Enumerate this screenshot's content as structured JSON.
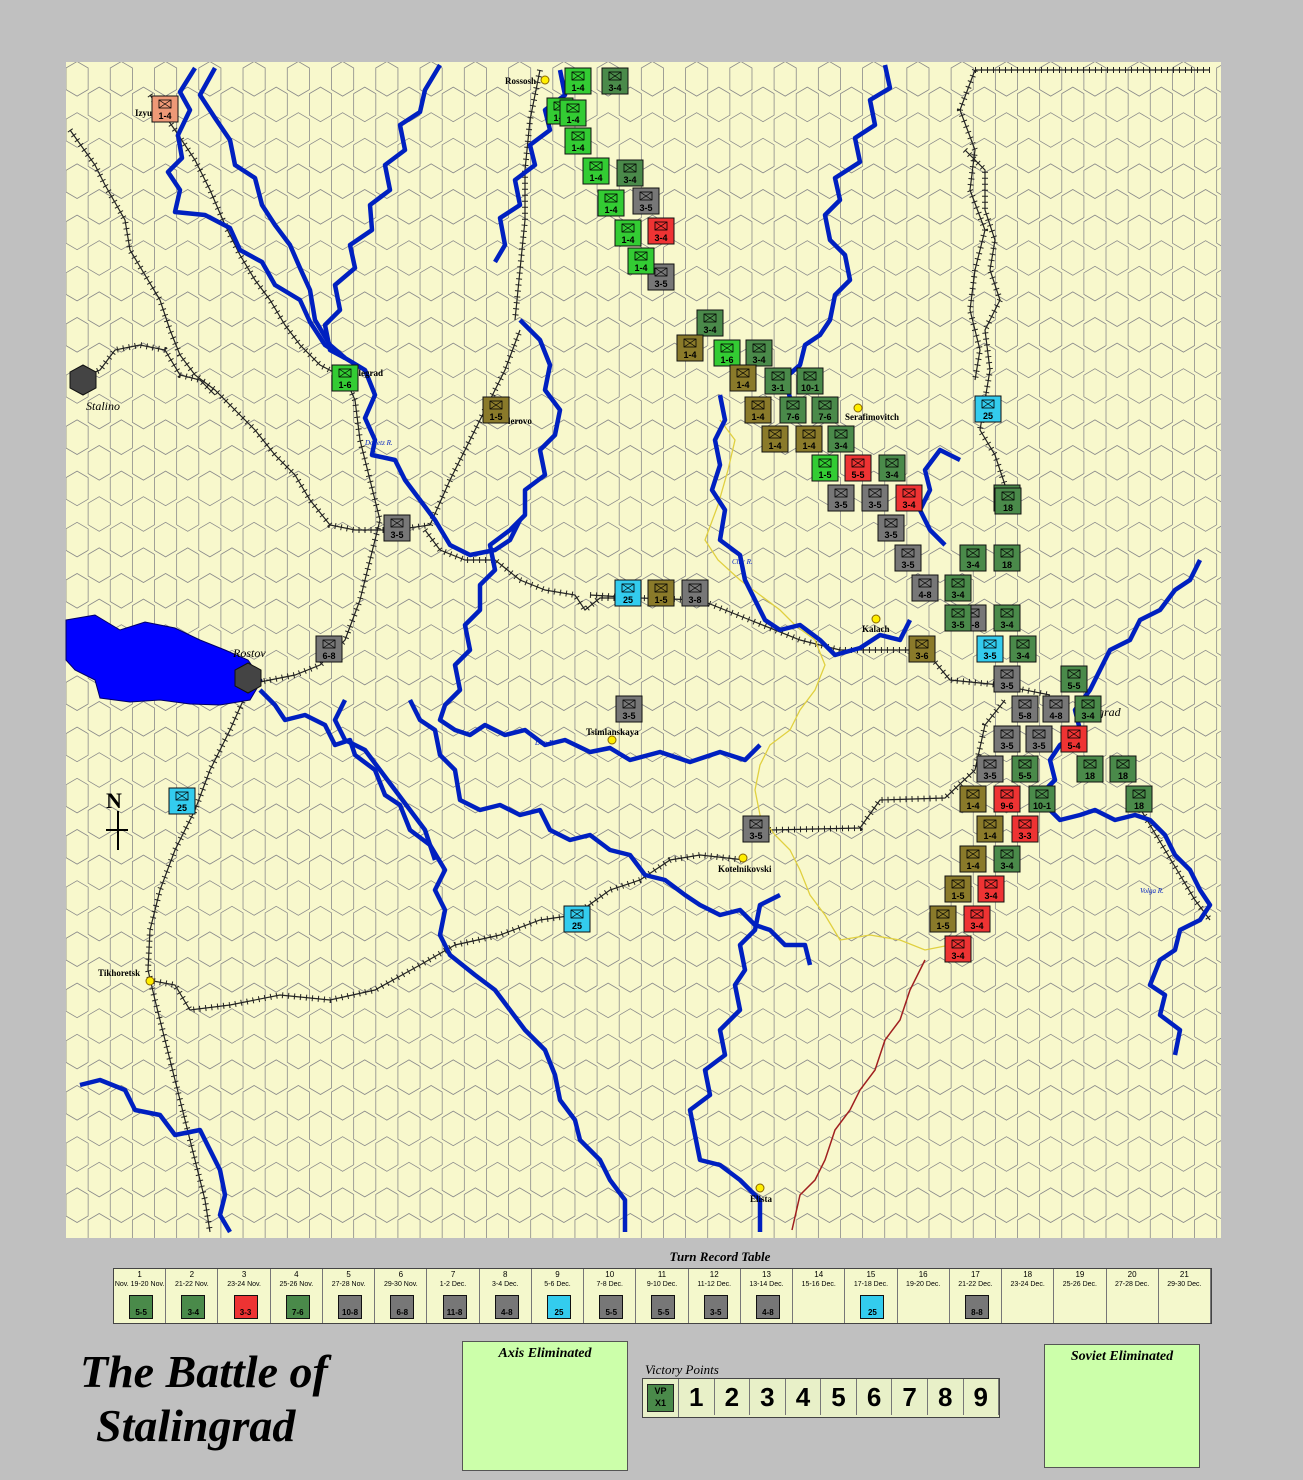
{
  "title": {
    "line1": "The Battle of",
    "line2": "Stalingrad"
  },
  "turn_record": {
    "title": "Turn Record Table",
    "turns": [
      {
        "num": "1",
        "date": "Nov. 19-20 Nov."
      },
      {
        "num": "2",
        "date": "21-22 Nov."
      },
      {
        "num": "3",
        "date": "23-24 Nov."
      },
      {
        "num": "4",
        "date": "25-26 Nov."
      },
      {
        "num": "5",
        "date": "27-28 Nov."
      },
      {
        "num": "6",
        "date": "29-30 Nov."
      },
      {
        "num": "7",
        "date": "1-2 Dec."
      },
      {
        "num": "8",
        "date": "3-4 Dec."
      },
      {
        "num": "9",
        "date": "5-6 Dec."
      },
      {
        "num": "10",
        "date": "7-8 Dec."
      },
      {
        "num": "11",
        "date": "9-10 Dec."
      },
      {
        "num": "12",
        "date": "11-12 Dec."
      },
      {
        "num": "13",
        "date": "13-14 Dec."
      },
      {
        "num": "14",
        "date": "15-16 Dec."
      },
      {
        "num": "15",
        "date": "17-18 Dec."
      },
      {
        "num": "16",
        "date": "19-20 Dec."
      },
      {
        "num": "17",
        "date": "21-22 Dec."
      },
      {
        "num": "18",
        "date": "23-24 Dec."
      },
      {
        "num": "19",
        "date": "25-26 Dec."
      },
      {
        "num": "20",
        "date": "27-28 Dec."
      },
      {
        "num": "21",
        "date": "29-30 Dec."
      }
    ],
    "reinforcements": [
      {
        "turn": 1,
        "label": "5-5",
        "color": "#4a8a4a"
      },
      {
        "turn": 2,
        "label": "3-4",
        "color": "#4a8a4a"
      },
      {
        "turn": 3,
        "label": "3-3",
        "color": "#ee3333"
      },
      {
        "turn": 4,
        "label": "7-6",
        "color": "#4a8a4a"
      },
      {
        "turn": 5,
        "label": "10-8",
        "color": "#777777"
      },
      {
        "turn": 6,
        "label": "6-8",
        "color": "#777777"
      },
      {
        "turn": 7,
        "label": "11-8",
        "color": "#777777"
      },
      {
        "turn": 8,
        "label": "4-8",
        "color": "#777777"
      },
      {
        "turn": 9,
        "label": "25",
        "color": "#33ccee"
      },
      {
        "turn": 10,
        "label": "5-5",
        "color": "#777777"
      },
      {
        "turn": 11,
        "label": "5-5",
        "color": "#777777"
      },
      {
        "turn": 12,
        "label": "3-5",
        "color": "#777777"
      },
      {
        "turn": 13,
        "label": "4-8",
        "color": "#777777"
      },
      {
        "turn": 15,
        "label": "25",
        "color": "#33ccee"
      },
      {
        "turn": 17,
        "label": "8-8",
        "color": "#777777"
      }
    ]
  },
  "eliminated": {
    "axis": "Axis Eliminated",
    "soviet": "Soviet Eliminated"
  },
  "victory_points": {
    "label": "Victory Points",
    "marker_line1": "VP",
    "marker_line2": "X1",
    "values": [
      "1",
      "2",
      "3",
      "4",
      "5",
      "6",
      "7",
      "8",
      "9"
    ]
  },
  "places": [
    {
      "name": "Rossosh",
      "kind": "small"
    },
    {
      "name": "Izyu",
      "kind": "small"
    },
    {
      "name": "Voroshilovgrad",
      "label": "ilegrad",
      "kind": "small"
    },
    {
      "name": "Stalino",
      "kind": "italic"
    },
    {
      "name": "Millerovo",
      "label": "lerovo",
      "kind": "small"
    },
    {
      "name": "Serafimovitch",
      "kind": "small"
    },
    {
      "name": "Kalach",
      "kind": "small"
    },
    {
      "name": "Stalingrad",
      "label": "ngrad",
      "kind": "italic"
    },
    {
      "name": "Rostov",
      "kind": "italic"
    },
    {
      "name": "Tsimlanskaya",
      "kind": "small"
    },
    {
      "name": "Kotelnikovski",
      "kind": "small"
    },
    {
      "name": "Tikhoretsk",
      "kind": "small"
    },
    {
      "name": "Elista",
      "kind": "small"
    }
  ],
  "rivers": [
    "Donetz R.",
    "Chir R.",
    "Don R.",
    "Volga R."
  ],
  "counters": [
    {
      "label": "1-4",
      "color": "#33cc33"
    },
    {
      "label": "3-4",
      "color": "#4a8a4a"
    },
    {
      "label": "1-4",
      "color": "#33cc33"
    },
    {
      "label": "1-4",
      "color": "#33cc33"
    },
    {
      "label": "1-4",
      "color": "#33cc33"
    },
    {
      "label": "3-4",
      "color": "#4a8a4a"
    },
    {
      "label": "1-4",
      "color": "#33cc33"
    },
    {
      "label": "3-5",
      "color": "#777777"
    },
    {
      "label": "1-4",
      "color": "#33cc33"
    },
    {
      "label": "3-4",
      "color": "#ee3333"
    },
    {
      "label": "1-4",
      "color": "#33cc33"
    },
    {
      "label": "3-5",
      "color": "#777777"
    },
    {
      "label": "1-4",
      "color": "#33cc33"
    },
    {
      "label": "3-4",
      "color": "#4a8a4a"
    },
    {
      "label": "1-4",
      "color": "#8a7a2a"
    },
    {
      "label": "1-6",
      "color": "#33cc33"
    },
    {
      "label": "3-4",
      "color": "#4a8a4a"
    },
    {
      "label": "1-4",
      "color": "#8a7a2a"
    },
    {
      "label": "3-1",
      "color": "#4a8a4a"
    },
    {
      "label": "10-1",
      "color": "#4a8a4a"
    },
    {
      "label": "1-4",
      "color": "#8a7a2a"
    },
    {
      "label": "7-6",
      "color": "#4a8a4a"
    },
    {
      "label": "7-6",
      "color": "#4a8a4a"
    },
    {
      "label": "1-4",
      "color": "#8a7a2a"
    },
    {
      "label": "1-4",
      "color": "#8a7a2a"
    },
    {
      "label": "3-4",
      "color": "#4a8a4a"
    },
    {
      "label": "1-5",
      "color": "#33cc33"
    },
    {
      "label": "5-5",
      "color": "#ee3333"
    },
    {
      "label": "3-4",
      "color": "#4a8a4a"
    },
    {
      "label": "3-5",
      "color": "#777777"
    },
    {
      "label": "3-5",
      "color": "#777777"
    },
    {
      "label": "3-4",
      "color": "#ee3333"
    },
    {
      "label": "3-5",
      "color": "#777777"
    },
    {
      "label": "3-5",
      "color": "#777777"
    },
    {
      "label": "3-4",
      "color": "#4a8a4a"
    },
    {
      "label": "18",
      "color": "#4a8a4a"
    },
    {
      "label": "4-8",
      "color": "#777777"
    },
    {
      "label": "3-4",
      "color": "#4a8a4a"
    },
    {
      "label": "18",
      "color": "#4a8a4a"
    },
    {
      "label": "4-8",
      "color": "#777777"
    },
    {
      "label": "3-5",
      "color": "#4a8a4a"
    },
    {
      "label": "3-4",
      "color": "#4a8a4a"
    },
    {
      "label": "3-5",
      "color": "#33ccee"
    },
    {
      "label": "3-4",
      "color": "#4a8a4a"
    },
    {
      "label": "3-5",
      "color": "#777777"
    },
    {
      "label": "5-5",
      "color": "#4a8a4a"
    },
    {
      "label": "5-8",
      "color": "#777777"
    },
    {
      "label": "4-8",
      "color": "#777777"
    },
    {
      "label": "3-4",
      "color": "#4a8a4a"
    },
    {
      "label": "3-5",
      "color": "#777777"
    },
    {
      "label": "3-5",
      "color": "#777777"
    },
    {
      "label": "5-4",
      "color": "#ee3333"
    },
    {
      "label": "3-5",
      "color": "#777777"
    },
    {
      "label": "5-5",
      "color": "#4a8a4a"
    },
    {
      "label": "18",
      "color": "#4a8a4a"
    },
    {
      "label": "18",
      "color": "#4a8a4a"
    },
    {
      "label": "1-4",
      "color": "#8a7a2a"
    },
    {
      "label": "9-6",
      "color": "#ee3333"
    },
    {
      "label": "10-1",
      "color": "#4a8a4a"
    },
    {
      "label": "18",
      "color": "#4a8a4a"
    },
    {
      "label": "1-4",
      "color": "#8a7a2a"
    },
    {
      "label": "3-3",
      "color": "#ee3333"
    },
    {
      "label": "1-4",
      "color": "#8a7a2a"
    },
    {
      "label": "3-4",
      "color": "#4a8a4a"
    },
    {
      "label": "1-5",
      "color": "#8a7a2a"
    },
    {
      "label": "3-4",
      "color": "#ee3333"
    },
    {
      "label": "1-5",
      "color": "#8a7a2a"
    },
    {
      "label": "3-4",
      "color": "#ee3333"
    },
    {
      "label": "3-4",
      "color": "#ee3333"
    },
    {
      "label": "1-4",
      "color": "#ee9977"
    },
    {
      "label": "1-5",
      "color": "#8a7a2a"
    },
    {
      "label": "1-6",
      "color": "#33cc33"
    },
    {
      "label": "3-5",
      "color": "#777777"
    },
    {
      "label": "25",
      "color": "#33ccee"
    },
    {
      "label": "1-5",
      "color": "#8a7a2a"
    },
    {
      "label": "3-8",
      "color": "#777777"
    },
    {
      "label": "3-6",
      "color": "#8a7a2a"
    },
    {
      "label": "6-8",
      "color": "#777777"
    },
    {
      "label": "3-5",
      "color": "#777777"
    },
    {
      "label": "25",
      "color": "#33ccee"
    },
    {
      "label": "3-5",
      "color": "#777777"
    },
    {
      "label": "25",
      "color": "#33ccee"
    },
    {
      "label": "25",
      "color": "#33ccee"
    },
    {
      "label": "18",
      "color": "#4a8a4a"
    },
    {
      "label": "18",
      "color": "#4a8a4a"
    },
    {
      "label": "18",
      "color": "#4a8a4a"
    }
  ]
}
